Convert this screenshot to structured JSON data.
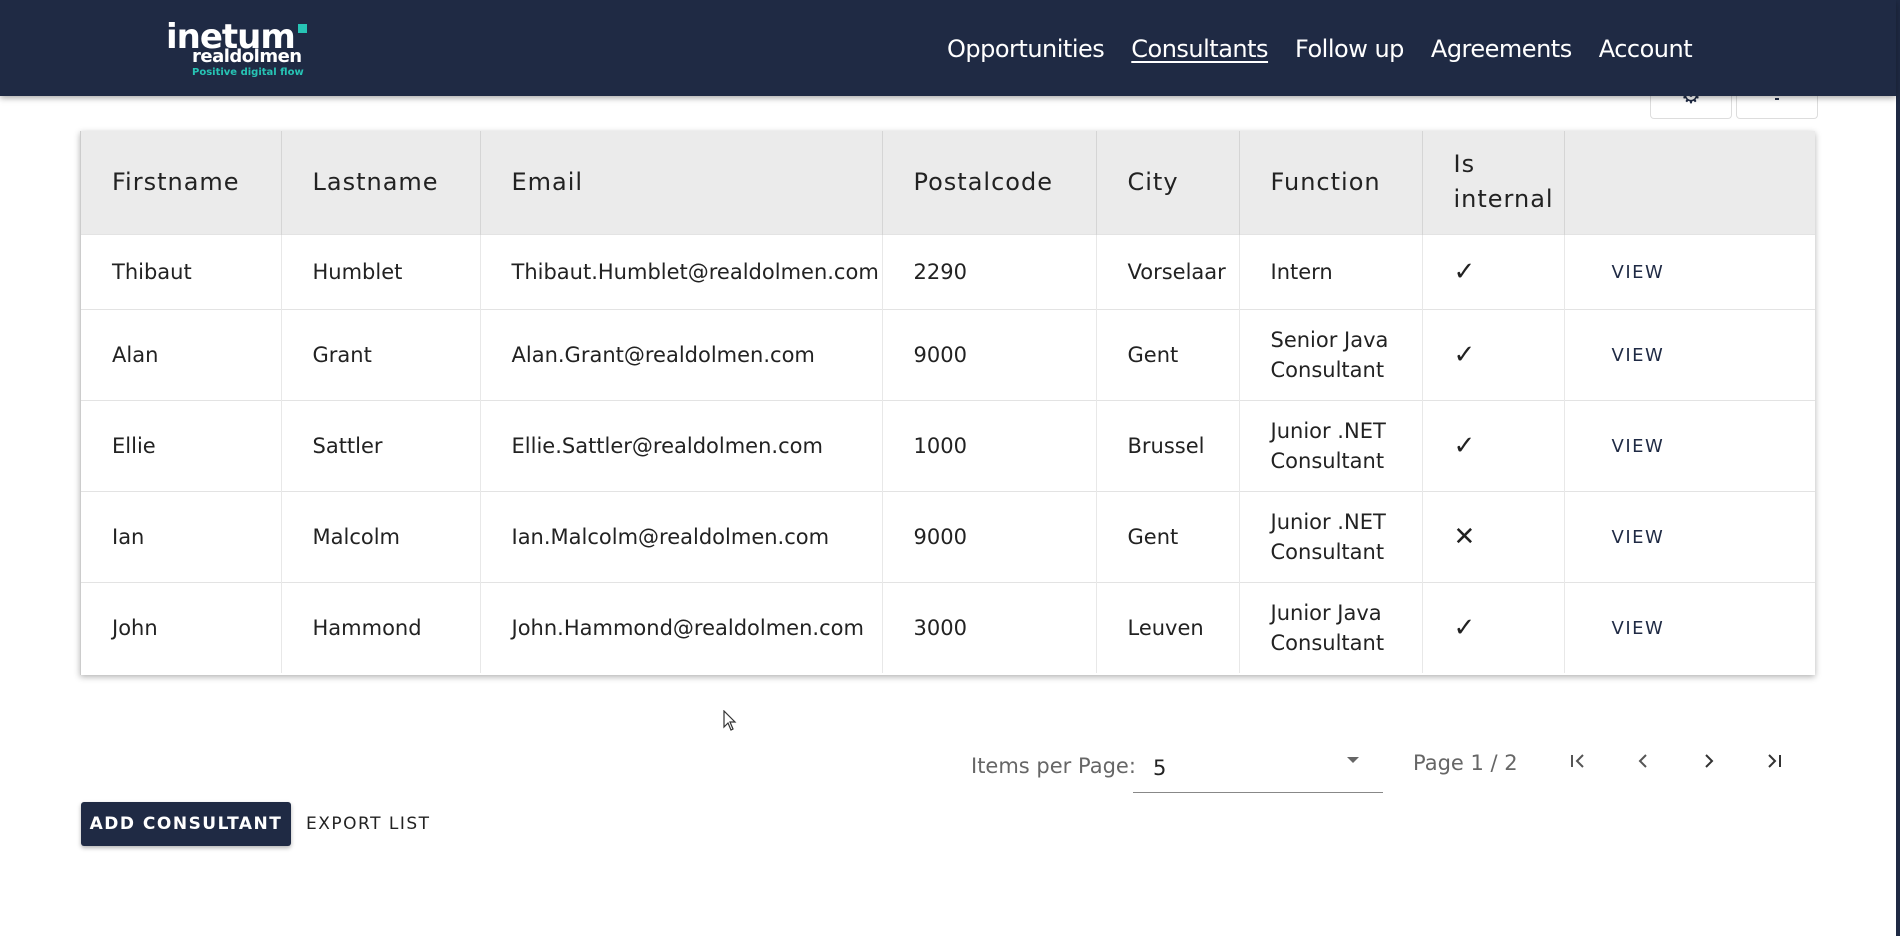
{
  "header": {
    "logo_line1": "inetum",
    "logo_line2": "realdolmen",
    "logo_line3": "Positive digital flow",
    "nav": [
      {
        "label": "Opportunities",
        "active": false
      },
      {
        "label": "Consultants",
        "active": true
      },
      {
        "label": "Follow up",
        "active": false
      },
      {
        "label": "Agreements",
        "active": false
      },
      {
        "label": "Account",
        "active": false
      }
    ]
  },
  "toolbar": {
    "settings_icon": "gear-icon",
    "filter_icon": "filter-icon"
  },
  "table": {
    "columns": [
      "Firstname",
      "Lastname",
      "Email",
      "Postalcode",
      "City",
      "Function",
      "Is internal",
      ""
    ],
    "rows": [
      {
        "firstname": "Thibaut",
        "lastname": "Humblet",
        "email": "Thibaut.Humblet@realdolmen.com",
        "postalcode": "2290",
        "city": "Vorselaar",
        "function": "Intern",
        "is_internal": "✓",
        "action": "VIEW"
      },
      {
        "firstname": "Alan",
        "lastname": "Grant",
        "email": "Alan.Grant@realdolmen.com",
        "postalcode": "9000",
        "city": "Gent",
        "function": "Senior Java Consultant",
        "is_internal": "✓",
        "action": "VIEW"
      },
      {
        "firstname": "Ellie",
        "lastname": "Sattler",
        "email": "Ellie.Sattler@realdolmen.com",
        "postalcode": "1000",
        "city": "Brussel",
        "function": "Junior .NET Consultant",
        "is_internal": "✓",
        "action": "VIEW"
      },
      {
        "firstname": "Ian",
        "lastname": "Malcolm",
        "email": "Ian.Malcolm@realdolmen.com",
        "postalcode": "9000",
        "city": "Gent",
        "function": "Junior .NET Consultant",
        "is_internal": "✕",
        "action": "VIEW"
      },
      {
        "firstname": "John",
        "lastname": "Hammond",
        "email": "John.Hammond@realdolmen.com",
        "postalcode": "3000",
        "city": "Leuven",
        "function": "Junior Java Consultant",
        "is_internal": "✓",
        "action": "VIEW"
      }
    ]
  },
  "pagination": {
    "items_label": "Items per Page:",
    "items_value": "5",
    "page_label": "Page 1 / 2"
  },
  "actions": {
    "add_label": "ADD CONSULTANT",
    "export_label": "EXPORT LIST"
  },
  "colors": {
    "brand_navy": "#1f2a44",
    "accent_teal": "#27c4b5",
    "header_row_bg": "#ebebeb"
  }
}
